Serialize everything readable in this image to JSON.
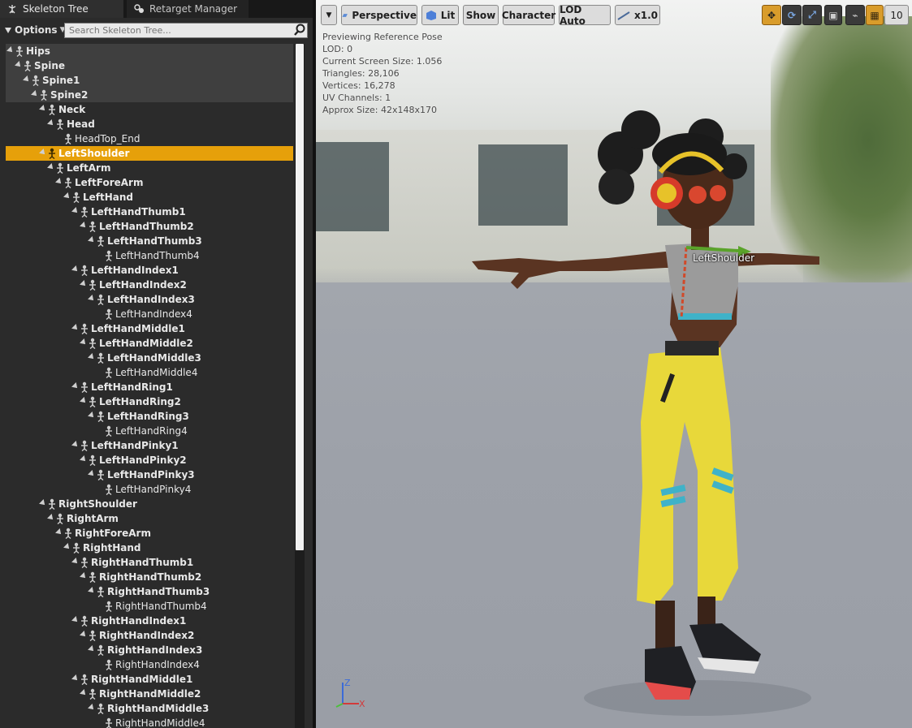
{
  "tabs": [
    {
      "label": "Skeleton Tree",
      "icon": "skeleton-icon",
      "active": true
    },
    {
      "label": "Retarget Manager",
      "icon": "retarget-icon",
      "active": false
    }
  ],
  "options": {
    "label": "Options"
  },
  "search": {
    "placeholder": "Search Skeleton Tree..."
  },
  "tree": [
    {
      "label": "Hips",
      "depth": 0,
      "expanded": true
    },
    {
      "label": "Spine",
      "depth": 1,
      "expanded": true
    },
    {
      "label": "Spine1",
      "depth": 2,
      "expanded": true
    },
    {
      "label": "Spine2",
      "depth": 3,
      "expanded": true
    },
    {
      "label": "Neck",
      "depth": 4,
      "expanded": true
    },
    {
      "label": "Head",
      "depth": 5,
      "expanded": true
    },
    {
      "label": "HeadTop_End",
      "depth": 6,
      "leaf": true
    },
    {
      "label": "LeftShoulder",
      "depth": 4,
      "expanded": true,
      "selected": true
    },
    {
      "label": "LeftArm",
      "depth": 5,
      "expanded": true
    },
    {
      "label": "LeftForeArm",
      "depth": 6,
      "expanded": true
    },
    {
      "label": "LeftHand",
      "depth": 7,
      "expanded": true
    },
    {
      "label": "LeftHandThumb1",
      "depth": 8,
      "expanded": true
    },
    {
      "label": "LeftHandThumb2",
      "depth": 9,
      "expanded": true
    },
    {
      "label": "LeftHandThumb3",
      "depth": 10,
      "expanded": true
    },
    {
      "label": "LeftHandThumb4",
      "depth": 11,
      "leaf": true
    },
    {
      "label": "LeftHandIndex1",
      "depth": 8,
      "expanded": true
    },
    {
      "label": "LeftHandIndex2",
      "depth": 9,
      "expanded": true
    },
    {
      "label": "LeftHandIndex3",
      "depth": 10,
      "expanded": true
    },
    {
      "label": "LeftHandIndex4",
      "depth": 11,
      "leaf": true
    },
    {
      "label": "LeftHandMiddle1",
      "depth": 8,
      "expanded": true
    },
    {
      "label": "LeftHandMiddle2",
      "depth": 9,
      "expanded": true
    },
    {
      "label": "LeftHandMiddle3",
      "depth": 10,
      "expanded": true
    },
    {
      "label": "LeftHandMiddle4",
      "depth": 11,
      "leaf": true
    },
    {
      "label": "LeftHandRing1",
      "depth": 8,
      "expanded": true
    },
    {
      "label": "LeftHandRing2",
      "depth": 9,
      "expanded": true
    },
    {
      "label": "LeftHandRing3",
      "depth": 10,
      "expanded": true
    },
    {
      "label": "LeftHandRing4",
      "depth": 11,
      "leaf": true
    },
    {
      "label": "LeftHandPinky1",
      "depth": 8,
      "expanded": true
    },
    {
      "label": "LeftHandPinky2",
      "depth": 9,
      "expanded": true
    },
    {
      "label": "LeftHandPinky3",
      "depth": 10,
      "expanded": true
    },
    {
      "label": "LeftHandPinky4",
      "depth": 11,
      "leaf": true
    },
    {
      "label": "RightShoulder",
      "depth": 4,
      "expanded": true
    },
    {
      "label": "RightArm",
      "depth": 5,
      "expanded": true
    },
    {
      "label": "RightForeArm",
      "depth": 6,
      "expanded": true
    },
    {
      "label": "RightHand",
      "depth": 7,
      "expanded": true
    },
    {
      "label": "RightHandThumb1",
      "depth": 8,
      "expanded": true
    },
    {
      "label": "RightHandThumb2",
      "depth": 9,
      "expanded": true
    },
    {
      "label": "RightHandThumb3",
      "depth": 10,
      "expanded": true
    },
    {
      "label": "RightHandThumb4",
      "depth": 11,
      "leaf": true
    },
    {
      "label": "RightHandIndex1",
      "depth": 8,
      "expanded": true
    },
    {
      "label": "RightHandIndex2",
      "depth": 9,
      "expanded": true
    },
    {
      "label": "RightHandIndex3",
      "depth": 10,
      "expanded": true
    },
    {
      "label": "RightHandIndex4",
      "depth": 11,
      "leaf": true
    },
    {
      "label": "RightHandMiddle1",
      "depth": 8,
      "expanded": true
    },
    {
      "label": "RightHandMiddle2",
      "depth": 9,
      "expanded": true
    },
    {
      "label": "RightHandMiddle3",
      "depth": 10,
      "expanded": true
    },
    {
      "label": "RightHandMiddle4",
      "depth": 11,
      "leaf": true
    }
  ],
  "viewport": {
    "toolbar": {
      "perspective": "Perspective",
      "lit": "Lit",
      "show": "Show",
      "character": "Character",
      "lod": "LOD Auto",
      "speed": "x1.0",
      "grid_size": "10"
    },
    "stats": [
      "Previewing Reference Pose",
      "LOD: 0",
      "Current Screen Size: 1.056",
      "Triangles: 28,106",
      "Vertices: 16,278",
      "UV Channels: 1",
      "Approx Size: 42x148x170"
    ],
    "selected_bone_label": "LeftShoulder",
    "axis_labels": {
      "z": "Z",
      "x": "X"
    }
  },
  "colors": {
    "selection": "#e6a00a",
    "panel_bg": "#2b2b2b",
    "pants": "#e8d83a"
  }
}
